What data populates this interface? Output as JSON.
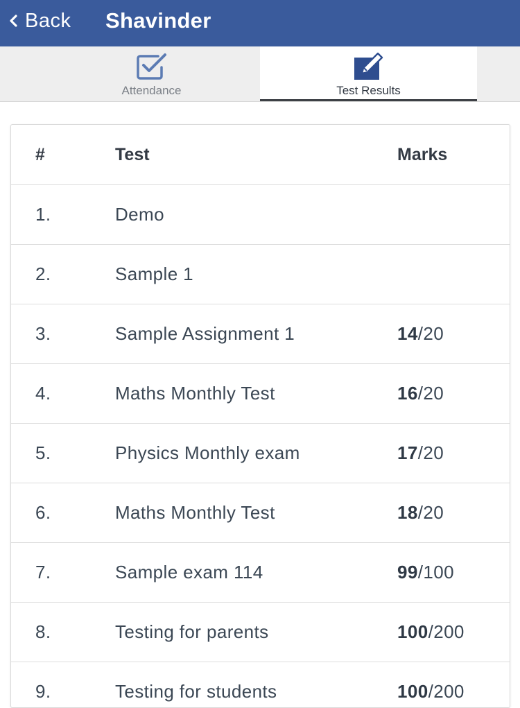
{
  "header": {
    "back_label": "Back",
    "title": "Shavinder",
    "background_color": "#3a5b9c"
  },
  "tabs": [
    {
      "label": "Attendance",
      "icon": "checkbox-icon",
      "active": false
    },
    {
      "label": "Test Results",
      "icon": "edit-icon",
      "active": true
    }
  ],
  "table": {
    "columns": [
      "#",
      "Test",
      "Marks"
    ],
    "rows": [
      {
        "index": "1.",
        "test": "Demo",
        "marks_obtained": "",
        "marks_total": ""
      },
      {
        "index": "2.",
        "test": "Sample 1",
        "marks_obtained": "",
        "marks_total": ""
      },
      {
        "index": "3.",
        "test": "Sample Assignment 1",
        "marks_obtained": "14",
        "marks_total": "/20"
      },
      {
        "index": "4.",
        "test": "Maths Monthly Test",
        "marks_obtained": "16",
        "marks_total": "/20"
      },
      {
        "index": "5.",
        "test": "Physics Monthly exam",
        "marks_obtained": "17",
        "marks_total": "/20"
      },
      {
        "index": "6.",
        "test": "Maths Monthly Test",
        "marks_obtained": "18",
        "marks_total": "/20"
      },
      {
        "index": "7.",
        "test": "Sample exam 114",
        "marks_obtained": "99",
        "marks_total": "/100"
      },
      {
        "index": "8.",
        "test": "Testing for parents",
        "marks_obtained": "100",
        "marks_total": "/200"
      },
      {
        "index": "9.",
        "test": "Testing for students",
        "marks_obtained": "100",
        "marks_total": "/200"
      }
    ]
  }
}
